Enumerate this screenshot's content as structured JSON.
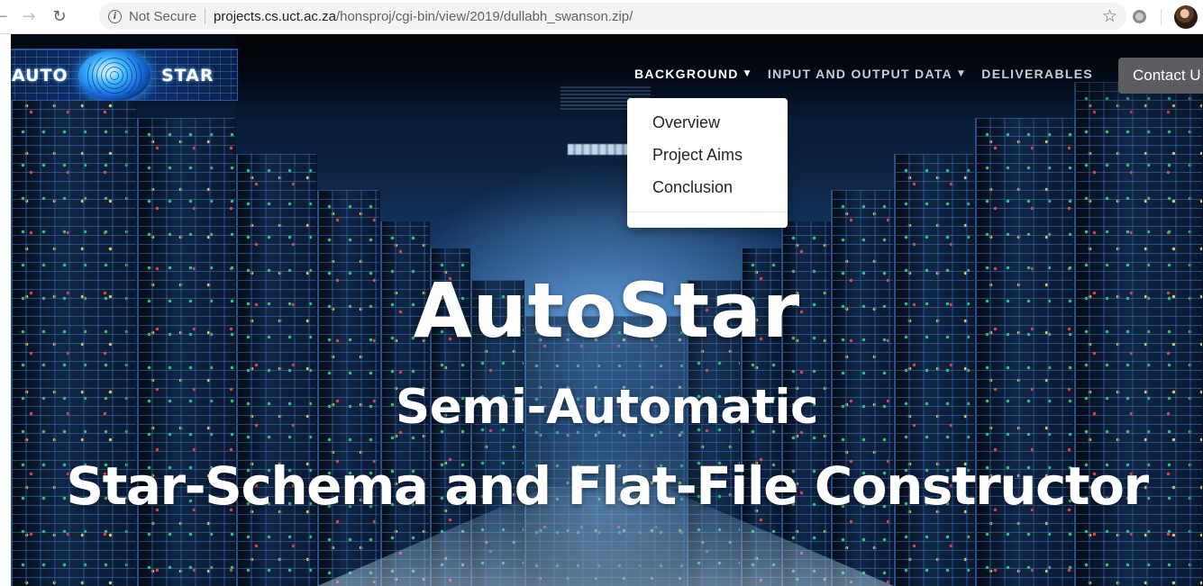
{
  "browser": {
    "back_icon": "arrow-left-icon",
    "forward_icon": "arrow-right-icon",
    "reload_icon": "reload-icon",
    "security_label": "Not Secure",
    "url_host": "projects.cs.uct.ac.za",
    "url_path": "/honsproj/cgi-bin/view/2019/dullabh_swanson.zip/",
    "bookmark_icon": "star-icon"
  },
  "logo": {
    "left_text": "AUTO",
    "right_text": "STAR"
  },
  "nav": {
    "items": [
      {
        "label": "BACKGROUND",
        "has_caret": true,
        "active": true
      },
      {
        "label": "INPUT AND OUTPUT DATA",
        "has_caret": true,
        "active": false
      },
      {
        "label": "DELIVERABLES",
        "has_caret": false,
        "active": false
      }
    ],
    "contact_label": "Contact U"
  },
  "dropdown": {
    "items": [
      "Overview",
      "Project Aims",
      "Conclusion"
    ]
  },
  "hero": {
    "title": "AutoStar",
    "subtitle_line1": "Semi-Automatic",
    "subtitle_line2": "Star-Schema and Flat-File Constructor"
  },
  "colors": {
    "contact_button": "#5b5d60",
    "nav_active": "#ffffff",
    "nav_inactive": "#c9ccd3",
    "hero_text": "#ffffff"
  }
}
